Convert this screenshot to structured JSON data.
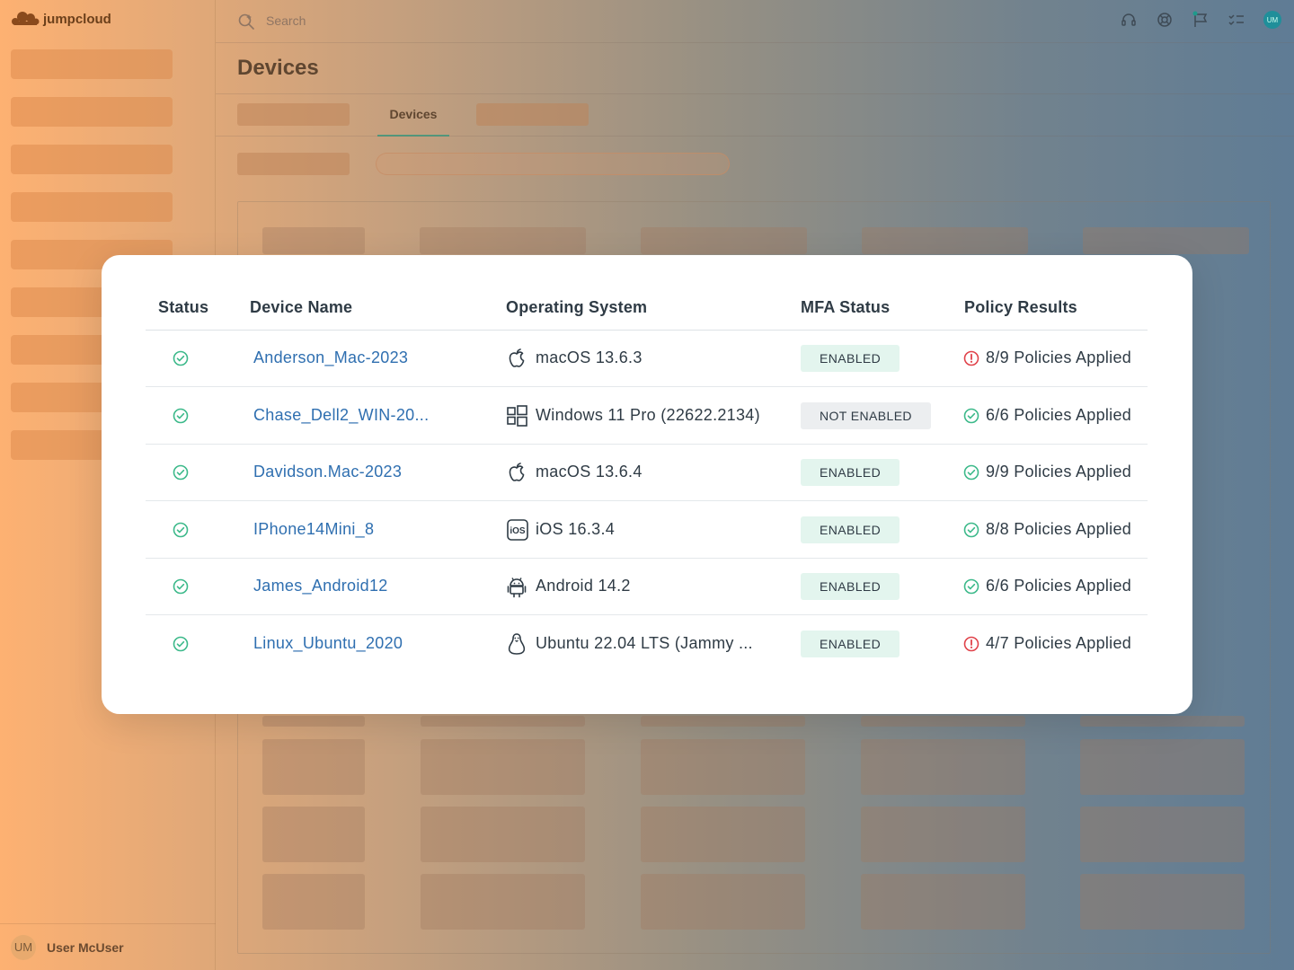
{
  "app": {
    "brand": "jumpcloud",
    "search_placeholder": "Search",
    "page_title": "Devices",
    "active_tab": "Devices",
    "user": {
      "initials": "UM",
      "name": "User McUser"
    },
    "top_avatar_initials": "UM"
  },
  "table": {
    "headers": {
      "status": "Status",
      "device_name": "Device Name",
      "os": "Operating System",
      "mfa": "MFA Status",
      "policy": "Policy Results"
    },
    "rows": [
      {
        "status": "ok",
        "device_name": "Anderson_Mac-2023",
        "os_icon": "apple-icon",
        "os": "macOS 13.6.3",
        "mfa": "ENABLED",
        "mfa_state": "on",
        "policy_state": "warning",
        "policy": "8/9 Policies Applied"
      },
      {
        "status": "ok",
        "device_name": "Chase_Dell2_WIN-20...",
        "os_icon": "windows-icon",
        "os": "Windows 11 Pro (22622.2134)",
        "mfa": "NOT ENABLED",
        "mfa_state": "off",
        "policy_state": "ok",
        "policy": "6/6 Policies Applied"
      },
      {
        "status": "ok",
        "device_name": "Davidson.Mac-2023",
        "os_icon": "apple-icon",
        "os": "macOS 13.6.4",
        "mfa": "ENABLED",
        "mfa_state": "on",
        "policy_state": "ok",
        "policy": "9/9 Policies Applied"
      },
      {
        "status": "ok",
        "device_name": "IPhone14Mini_8",
        "os_icon": "ios-icon",
        "os": "iOS 16.3.4",
        "mfa": "ENABLED",
        "mfa_state": "on",
        "policy_state": "ok",
        "policy": "8/8 Policies Applied"
      },
      {
        "status": "ok",
        "device_name": "James_Android12",
        "os_icon": "android-icon",
        "os": "Android 14.2",
        "mfa": "ENABLED",
        "mfa_state": "on",
        "policy_state": "ok",
        "policy": "6/6 Policies Applied"
      },
      {
        "status": "ok",
        "device_name": "Linux_Ubuntu_2020",
        "os_icon": "linux-icon",
        "os": "Ubuntu 22.04 LTS (Jammy ...",
        "mfa": "ENABLED",
        "mfa_state": "on",
        "policy_state": "warning",
        "policy": "4/7 Policies Applied"
      }
    ]
  },
  "colors": {
    "ok": "#3cb98a",
    "warning": "#e0424a",
    "link": "#2f6fb0",
    "enabled_badge": "#e3f5ee",
    "not_enabled_badge": "#eceef0"
  }
}
